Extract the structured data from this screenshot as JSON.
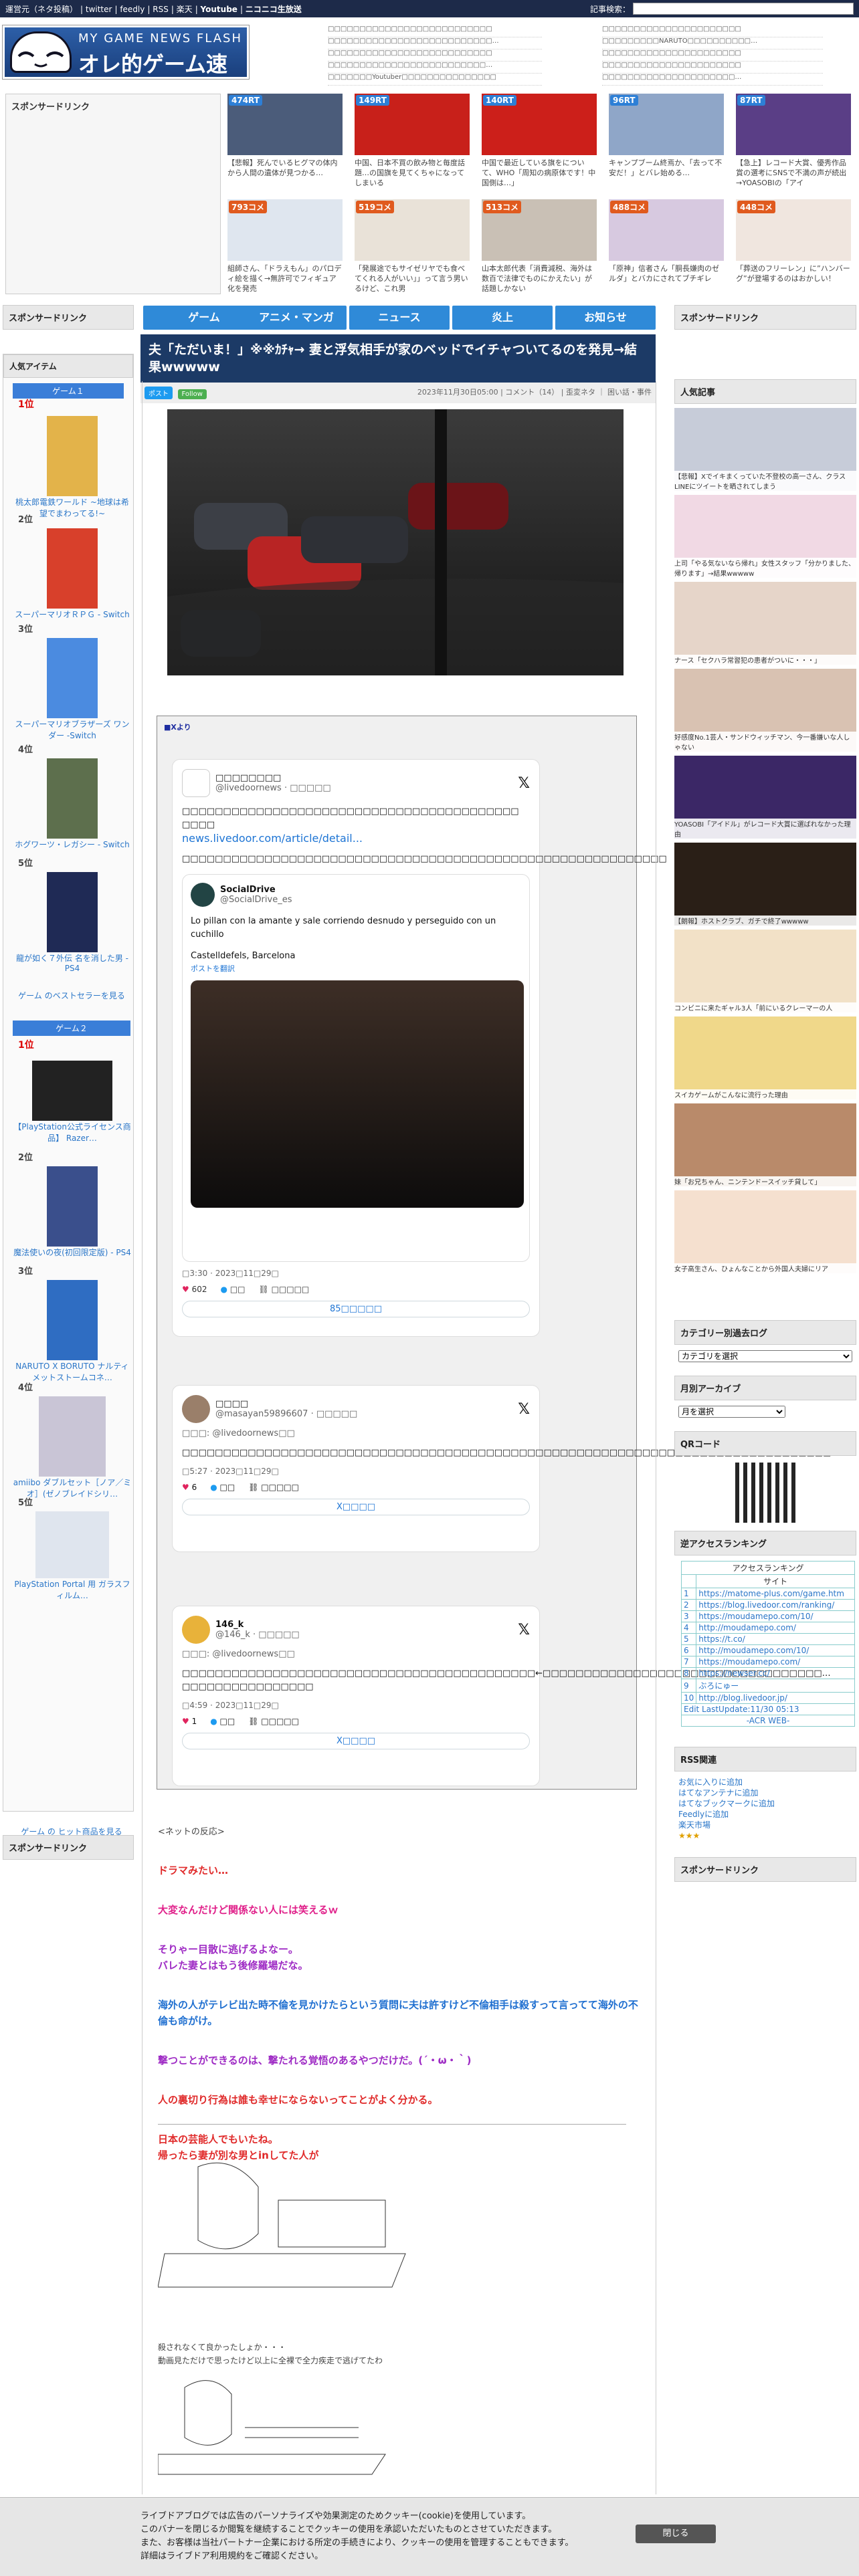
{
  "topbar": {
    "links": [
      "運営元（ネタ投稿）",
      "twitter",
      "feedly",
      "RSS",
      "楽天",
      "Youtube",
      "ニコニコ生放送"
    ],
    "search_label": "記事検索："
  },
  "logo": {
    "sub": "MY GAME NEWS FLASH",
    "main": "オレ的ゲーム速報@JIN"
  },
  "header_news_left": [
    "□□□□□□□□□□□□□□□□□□□□□□□□□□",
    "□□□□□□□□□□□□□□□□□□□□□□□□□□…",
    "□□□□□□□□□□□□□□□□□□□□□□□□□□",
    "□□□□□□□□□□□□□□□□□□□□□□□□□…",
    "□□□□□□□Youtuber□□□□□□□□□□□□□□□"
  ],
  "header_news_right": [
    "□□□□□□□□□□□□□□□□□□□□□□",
    "□□□□□□□□□NARUTO□□□□□□□□□□…",
    "□□□□□□□□□□□□□□□□□□□□□□",
    "□□□□□□□□□□□□□□□□□□□□□□",
    "□□□□□□□□□□□□□□□□□□□□□…"
  ],
  "sponsored": "スポンサードリンク",
  "thumbs_top": [
    {
      "tag": "474RT",
      "cap": "【悲報】死んでいるヒグマの体内から人間の遺体が見つかる…"
    },
    {
      "tag": "149RT",
      "cap": "中国、日本不買の飲み物と毎度話題…の国旗を見てくちゃになってしまいる"
    },
    {
      "tag": "140RT",
      "cap": "中国で最近している旗をについて、WHO「周知の病原体です！中国側は…」"
    },
    {
      "tag": "96RT",
      "cap": "キャンプブーム終焉か、「去って不安だ！」とバレ始める…"
    },
    {
      "tag": "87RT",
      "cap": "【急上】レコード大賞、優秀作品賞の選考にSNSで不満の声が続出→YOASOBIの「アイ"
    }
  ],
  "thumbs_bottom": [
    {
      "tag": "793コメ",
      "cap": "組師さん、「ドラえもん」のパロディ絵を描く→無許可でフィギュア化を発売"
    },
    {
      "tag": "519コメ",
      "cap": "「発展途でもサイゼリヤでも食べてくれる人がいい」」って言う男いるけど、これ男"
    },
    {
      "tag": "513コメ",
      "cap": "山本太郎代表「消費減税、海外は数百で法律でものにかえたい」が話題しかない"
    },
    {
      "tag": "488コメ",
      "cap": "「原神」信者さん「胴長嫌肉のゼルダ」とバカにされてブチギレ"
    },
    {
      "tag": "448コメ",
      "cap": "「葬送のフリーレン」に”ハンバーグ”が登場するのはおかしい！"
    }
  ],
  "nav": [
    "ゲーム",
    "アニメ・マンガ",
    "ニュース",
    "炎上",
    "お知らせ"
  ],
  "left": {
    "popular": "人気アイテム",
    "game1": "ゲーム１",
    "game2": "ゲーム２",
    "items1": [
      {
        "no": "1位",
        "title": "桃太郎電鉄ワールド ~地球は希望でまわってる!~"
      },
      {
        "no": "2位",
        "title": "スーパーマリオＲＰＧ - Switch"
      },
      {
        "no": "3位",
        "title": "スーパーマリオブラザーズ ワンダー -Switch"
      },
      {
        "no": "4位",
        "title": "ホグワーツ・レガシー - Switch"
      },
      {
        "no": "5位",
        "title": "龍が如く７外伝 名を消した男 - PS4"
      }
    ],
    "more1": "ゲーム のベストセラーを見る",
    "items2": [
      {
        "no": "1位",
        "title": "【PlayStation公式ライセンス商品】 Razer…"
      },
      {
        "no": "2位",
        "title": "魔法使いの夜(初回限定版) - PS4"
      },
      {
        "no": "3位",
        "title": "NARUTO X BORUTO ナルティメットストームコネ…"
      },
      {
        "no": "4位",
        "title": "amiibo ダブルセット［ノア／ミオ］(ゼノブレイドシリ…"
      },
      {
        "no": "5位",
        "title": "PlayStation Portal 用 ガラスフィルム…"
      }
    ],
    "more2": "ゲーム の ヒット商品を見る"
  },
  "article": {
    "title": "夫「ただいま！」※※ｶﾁｬ→ 妻と浮気相手が家のベッドでイチャついてるのを発見→結果wwwww",
    "tweet_btn": "ポスト",
    "follow_btn": "Follow",
    "date": "2023年11月30日05:00",
    "comments": "コメント（14）",
    "category": "歪変ネタ ｜ 困い話・事件",
    "xsource": "Xより",
    "tweets": [
      {
        "name": "□□□□□□□□ ",
        "handle": "@livedoornews · □□□□□",
        "text": "□□□□□□□□□□□□□□□□□□□□□□□□□□□□□□□□□□□□□□□□□ □□□□",
        "link": "news.livedoor.com/article/detail...",
        "text2": "□□□□□□□□□□□□□□□□□□□□□□□□□□□□□□□□□□□□□□□□□□□□□□□□□□□□□□□□□□□",
        "q_name": "SocialDrive",
        "q_handle": "@SocialDrive_es",
        "q_text": "Lo pillan con la amante y sale corriendo desnudo y perseguido con un cuchillo",
        "q_loc": "Castelldefels, Barcelona",
        "q_trans": "ポストを翻訳",
        "time": "□3:30 · 2023□11□29□",
        "likes": "602",
        "reply": "□□",
        "share": "□□□□□",
        "more": "85□□□□□"
      },
      {
        "name": "□□□□ ",
        "handle": "@masayan59896607 · □□□□□",
        "reply_to": "□□□: @livedoornews□□",
        "text": "□□□□□□□□□□□□□□□□□□□□□□□□□□□□□□□□□□□□□□□□□□□□□□□□□□□□□□□□□□□□□□□□□□□□□□□□□□□□□□□",
        "time": "□5:27 · 2023□11□29□",
        "likes": "6",
        "reply": "□□",
        "share": "□□□□□",
        "more": "X□□□□"
      },
      {
        "name": "146_k",
        "handle": "@146_k · □□□□□",
        "reply_to": "□□□: @livedoornews□□",
        "text": "□□□□□□□□□□□□□□□□□□□□□□□□□□□□□□□□□□□□□□□□□□□←□□□□□□□□□□□□□□□□□□□□□□□□□□□□□□□□□□…□□□□□□□□□□□□□□□□",
        "time": "□4:59 · 2023□11□29□",
        "likes": "1",
        "reply": "□□",
        "share": "□□□□□",
        "more": "X□□□□"
      }
    ],
    "net_reaction": "<ネットの反応>",
    "replies": [
      {
        "text": "ドラマみたい…",
        "color": "red"
      },
      {
        "text": "大変なんだけど関係ない人には笑えるｗ",
        "color": "pink"
      },
      {
        "text": "そりゃー目散に逃げるよなー。\nバレた妻とはもう後修羅場だな。",
        "color": "purple"
      },
      {
        "text": "海外の人がテレビ出た時不倫を見かけたらという質問に夫は許すけど不倫相手は殺すって言ってて海外の不倫も命がけ。",
        "color": "blue"
      },
      {
        "text": "撃つことができるのは、撃たれる覚悟のあるやつだけだ。(´・ω・｀)",
        "color": "purple"
      },
      {
        "text": "人の裏切り行為は誰も幸せにならないってことがよく分かる。",
        "color": "red"
      },
      {
        "text": "日本の芸能人でもいたね。\n帰ったら妻が別な男とinしてた人が",
        "color": "red"
      }
    ],
    "aa_caption1": "殺されなくて良かったしょか・・・",
    "aa_caption2": "動画見ただけで思ったけど以上に全裸で全力疾走で逃げてたわ"
  },
  "right": {
    "sponsored": "スポンサードリンク",
    "popular": "人気記事",
    "popular_caps": [
      "【悲報】Xでイキまくっていた不登校の高一さん、クラスLINEにツイートを晒されてしまう",
      "上司「やる気ないなら帰れ」女性スタッフ「分かりました、帰ります」→結果wwwww",
      "ナース「セクハラ常習犯の患者がついに・・・」",
      "好感度No.1芸人・サンドウィッチマン、今一番嫌いな人しゃない",
      "YOASOBI「アイドル」がレコード大賞に選ばれなかった理由",
      "【朗報】ホストクラブ、ガチで終了wwwww",
      "コンビニに来たギャル3人「前にいるクレーマーの人",
      "スイカゲームがこんなに流行った理由",
      "妹「お兄ちゃん、ニンテンドースイッチ貸して」",
      "女子高生さん、ひょんなことから外国人夫婦にリア"
    ],
    "category_title": "カテゴリー別過去ログ",
    "category_select": "カテゴリを選択",
    "archive_title": "月別アーカイブ",
    "archive_select": "月を選択",
    "qr_title": "QRコード",
    "access_title": "逆アクセスランキング",
    "access_head": "アクセスランキング",
    "access_sub": "サイト",
    "access_rows": [
      "https://matome-plus.com/game.htm",
      "https://blog.livedoor.com/ranking/",
      "https://moudamepo.com/10/",
      "http://moudamepo.com/",
      "https://t.co/",
      "http://moudamepo.com/10/",
      "https://moudamepo.com/",
      "https://newser.cc/",
      "ぶろにゅー",
      "http://blog.livedoor.jp/"
    ],
    "access_foot": "Edit LastUpdate:11/30 05:13",
    "access_brand": "-ACR WEB-",
    "rss_title": "RSS関連",
    "rss_links": [
      "お気に入りに追加",
      "はてなアンテナに追加",
      "はてなブックマークに追加",
      "Feedlyに追加",
      "楽天市場"
    ],
    "sponsored2": "スポンサードリンク"
  },
  "left_bottom_sponsored": "スポンサードリンク",
  "cookie": {
    "lines": [
      "ライブドアブログでは広告のパーソナライズや効果測定のためクッキー(cookie)を使用しています。",
      "このバナーを閉じるか閲覧を継続することでクッキーの使用を承認いただいたものとさせていただきます。",
      "また、お客様は当社パートナー企業における所定の手続きにより、クッキーの使用を管理することもできます。",
      "詳細はライブドア利用規約をご確認ください。"
    ],
    "close": "閉じる"
  },
  "colors": {
    "topbar": "#1d2a49",
    "nav": "#2f8ad8",
    "title_bg": "#1c3a66",
    "rank_red": "#dd0000"
  }
}
